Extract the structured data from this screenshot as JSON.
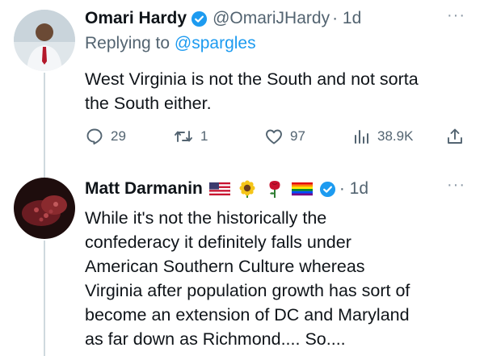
{
  "tweet1": {
    "name": "Omari Hardy",
    "handle": "@OmariJHardy",
    "time": "· 1d",
    "replying_prefix": "Replying to ",
    "replying_handle": "@spargles",
    "text_line1": "West Virginia is not the South and not sorta",
    "text_line2": "the South either.",
    "replies": "29",
    "retweets": "1",
    "likes": "97",
    "views": "38.9K",
    "more": "···"
  },
  "tweet2": {
    "name": "Matt Darmanin",
    "time": "· 1d",
    "flair_emojis": [
      "us-flag-emoji",
      "sunflower-emoji",
      "rose-emoji",
      "rainbow-flag-emoji"
    ],
    "text_lines": [
      "While it's not the historically the",
      "confederacy it definitely falls under",
      "American Southern Culture whereas",
      "Virginia after population growth has sort of",
      "become an extension of DC and Maryland",
      "as far down as Richmond.... So...."
    ],
    "more": "···"
  },
  "colors": {
    "text": "#0f1419",
    "muted": "#536471",
    "link": "#1d9bf0",
    "verified": "#1d9bf0",
    "thread_line": "#cfd9de"
  }
}
